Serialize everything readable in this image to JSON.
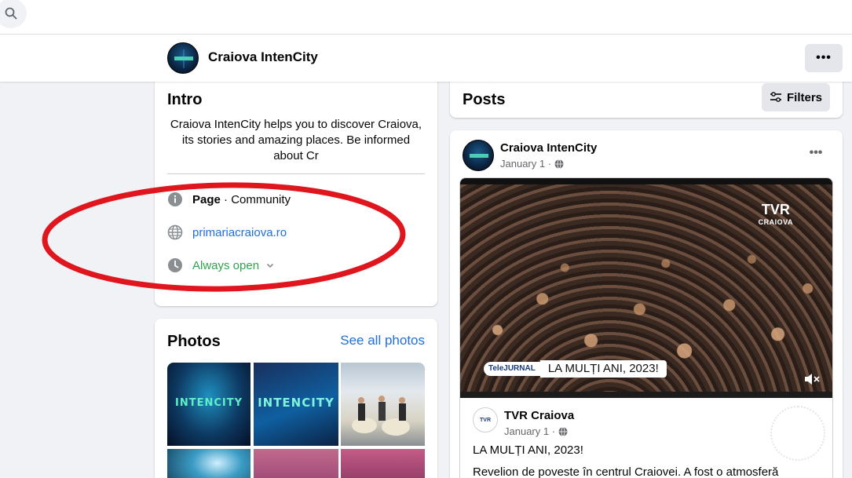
{
  "topbar": {
    "search_icon": "search-icon"
  },
  "header": {
    "page_name": "Craiova IntenCity",
    "more_icon": "more-horizontal-icon",
    "more_label": "•••"
  },
  "intro": {
    "title": "Intro",
    "description": "Craiova IntenCity helps you to discover Craiova, its stories and amazing places. Be informed about Cr",
    "category_label": "Page",
    "category_separator": " · ",
    "category_value": "Community",
    "website": "primariacraiova.ro",
    "hours": "Always open",
    "icons": [
      "info-icon",
      "globe-icon",
      "clock-icon",
      "chevron-down-icon"
    ]
  },
  "photos": {
    "title": "Photos",
    "see_all": "See all photos",
    "p1_logo": "INTENCITY",
    "p2_logo": "INTENCITY"
  },
  "posts": {
    "title": "Posts",
    "filters_label": "Filters"
  },
  "post": {
    "author": "Craiova IntenCity",
    "date": "January 1 ·",
    "more_label": "•••",
    "video": {
      "channel_logo": "TVR",
      "channel_sub": "CRAIOVA",
      "lower_third_badge": "TeleJURNAL",
      "lower_third_text": "LA MULȚI ANI, 2023!"
    },
    "shared": {
      "author": "TVR Craiova",
      "avatar_text": "TVR",
      "date": "January 1 ·",
      "line1": "LA MULȚI ANI, 2023!",
      "line2": "Revelion de poveste în centrul Craiovei. A fost o atmosferă"
    }
  },
  "colors": {
    "link": "#216fdb",
    "open": "#31a24c",
    "annotation": "#e0161e",
    "background": "#f0f2f5"
  }
}
